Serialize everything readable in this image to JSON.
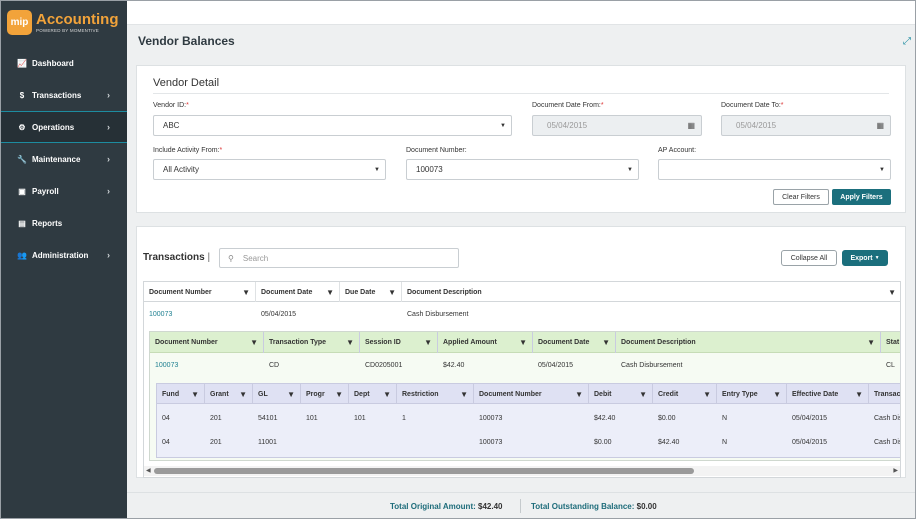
{
  "brand": {
    "badge": "mip",
    "title": "Accounting",
    "subtitle": "POWERED BY MOMENTIVE"
  },
  "nav": [
    {
      "label": "Dashboard",
      "icon": "chart-line-icon",
      "glyph": "📈",
      "chevron": false
    },
    {
      "label": "Transactions",
      "icon": "dollar-icon",
      "glyph": "$",
      "chevron": true
    },
    {
      "label": "Operations",
      "icon": "gears-icon",
      "glyph": "⚙",
      "chevron": true,
      "active": true
    },
    {
      "label": "Maintenance",
      "icon": "wrench-icon",
      "glyph": "🔧",
      "chevron": true
    },
    {
      "label": "Payroll",
      "icon": "money-icon",
      "glyph": "▣",
      "chevron": true
    },
    {
      "label": "Reports",
      "icon": "document-icon",
      "glyph": "▤",
      "chevron": false
    },
    {
      "label": "Administration",
      "icon": "users-icon",
      "glyph": "👥",
      "chevron": true
    }
  ],
  "page": {
    "title": "Vendor Balances"
  },
  "detail": {
    "title": "Vendor Detail",
    "vendor_id": {
      "label": "Vendor ID:",
      "value": "ABC"
    },
    "date_from": {
      "label": "Document Date From:",
      "value": "05/04/2015"
    },
    "date_to": {
      "label": "Document Date To:",
      "value": "05/04/2015"
    },
    "activity_from": {
      "label": "Include Activity From:",
      "value": "All Activity"
    },
    "doc_number": {
      "label": "Document Number:",
      "value": "100073"
    },
    "ap_account": {
      "label": "AP Account:",
      "value": ""
    },
    "clear_label": "Clear Filters",
    "apply_label": "Apply Filters"
  },
  "transactions": {
    "title": "Transactions",
    "search_placeholder": "Search",
    "collapse_label": "Collapse All",
    "export_label": "Export",
    "grid": {
      "columns": [
        "Document Number",
        "Document Date",
        "Due Date",
        "Document Description"
      ],
      "row": {
        "doc": "100073",
        "date": "05/04/2015",
        "due": "",
        "desc": "Cash Disbursement"
      }
    },
    "sub1": {
      "columns": [
        "Document Number",
        "Transaction Type",
        "Session ID",
        "Applied Amount",
        "Document Date",
        "Document Description",
        "Stat"
      ],
      "row": {
        "doc": "100073",
        "type": "CD",
        "session": "CD0205001",
        "applied": "$42.40",
        "date": "05/04/2015",
        "desc": "Cash Disbursement",
        "stat": "CL"
      }
    },
    "sub2": {
      "columns": [
        "Fund",
        "Grant",
        "GL",
        "Progr",
        "Dept",
        "Restriction",
        "Document Number",
        "Debit",
        "Credit",
        "Entry Type",
        "Effective Date",
        "Transac"
      ],
      "rows": [
        {
          "fund": "04",
          "grant": "201",
          "gl": "54101",
          "progr": "101",
          "dept": "101",
          "restriction": "1",
          "doc": "100073",
          "debit": "$42.40",
          "credit": "$0.00",
          "entry": "N",
          "eff": "05/04/2015",
          "trans": "Cash Dis"
        },
        {
          "fund": "04",
          "grant": "201",
          "gl": "11001",
          "progr": "",
          "dept": "",
          "restriction": "",
          "doc": "100073",
          "debit": "$0.00",
          "credit": "$42.40",
          "entry": "N",
          "eff": "05/04/2015",
          "trans": "Cash Dis"
        }
      ]
    }
  },
  "footer": {
    "orig_label": "Total Original Amount:",
    "orig_value": "$42.40",
    "outstanding_label": "Total Outstanding Balance:",
    "outstanding_value": "$0.00"
  },
  "colors": {
    "sidebar": "#2f3a41",
    "accent": "#1d8ca0",
    "primary": "#1b6f7d",
    "brand": "#f2a33a"
  }
}
